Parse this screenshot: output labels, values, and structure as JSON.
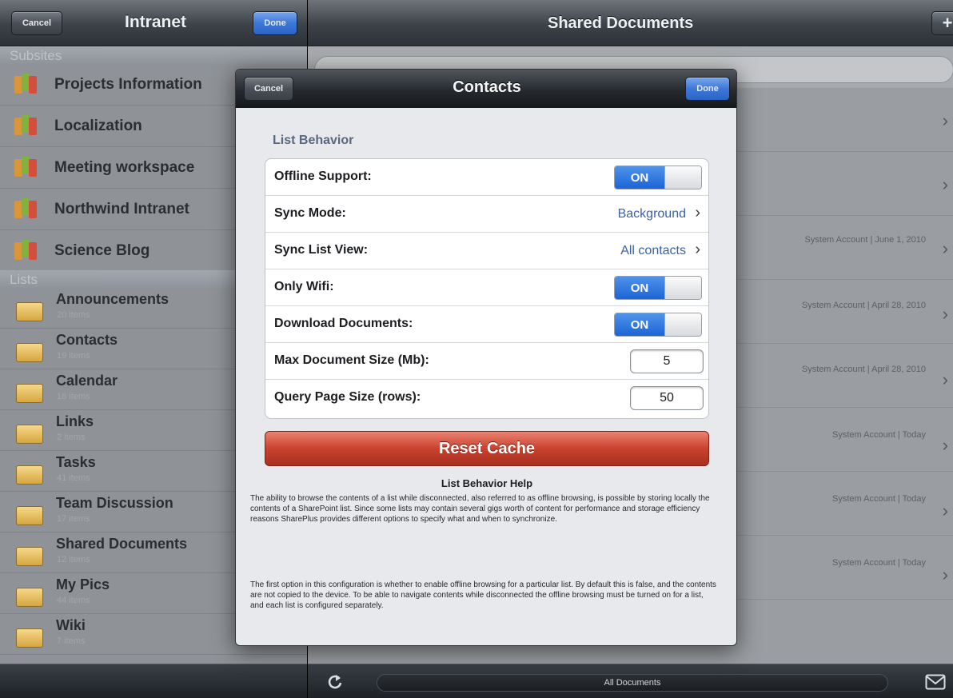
{
  "sidebar": {
    "cancel_label": "Cancel",
    "title": "Intranet",
    "done_label": "Done",
    "subsites_header": "Subsites",
    "subsites": [
      {
        "label": "Projects Information"
      },
      {
        "label": "Localization"
      },
      {
        "label": "Meeting workspace"
      },
      {
        "label": "Northwind Intranet"
      },
      {
        "label": "Science Blog"
      }
    ],
    "lists_header": "Lists",
    "lists": [
      {
        "label": "Announcements",
        "count": "20 items"
      },
      {
        "label": "Contacts",
        "count": "19 items"
      },
      {
        "label": "Calendar",
        "count": "16 items"
      },
      {
        "label": "Links",
        "count": "2 items"
      },
      {
        "label": "Tasks",
        "count": "41 items"
      },
      {
        "label": "Team Discussion",
        "count": "17 items"
      },
      {
        "label": "Shared Documents",
        "count": "12 items"
      },
      {
        "label": "My Pics",
        "count": "44 items"
      },
      {
        "label": "Wiki",
        "count": "7 items"
      }
    ]
  },
  "main": {
    "title": "Shared Documents",
    "add_label": "+",
    "rows": [
      {
        "meta": ""
      },
      {
        "meta": ""
      },
      {
        "meta": "System Account | June 1, 2010"
      },
      {
        "meta": "System Account | April 28, 2010"
      },
      {
        "meta": "System Account | April 28, 2010"
      },
      {
        "meta": "System Account | Today"
      },
      {
        "meta": "System Account | Today"
      },
      {
        "meta": "System Account | Today"
      }
    ],
    "toolbar_label": "All Documents"
  },
  "modal": {
    "cancel_label": "Cancel",
    "title": "Contacts",
    "done_label": "Done",
    "section_title": "List Behavior",
    "offline_support_label": "Offline Support:",
    "offline_support_state": "ON",
    "sync_mode_label": "Sync Mode:",
    "sync_mode_value": "Background",
    "sync_list_view_label": "Sync List View:",
    "sync_list_view_value": "All contacts",
    "only_wifi_label": "Only Wifi:",
    "only_wifi_state": "ON",
    "download_documents_label": "Download Documents:",
    "download_documents_state": "ON",
    "max_doc_size_label": "Max Document Size (Mb):",
    "max_doc_size_value": "5",
    "query_page_size_label": "Query Page Size (rows):",
    "query_page_size_value": "50",
    "reset_label": "Reset Cache",
    "help_title": "List Behavior Help",
    "help_p1": "The ability to browse the contents of a list while disconnected, also referred to as offline browsing, is possible by storing locally the contents of a SharePoint list. Since some lists may contain several gigs worth of content for performance and storage efficiency reasons SharePlus provides different options to specify what and when to synchronize.",
    "help_p2": "The first option in this configuration is whether to enable offline browsing for a particular list. By default this is false, and the contents are not copied to the device. To be able to navigate contents while disconnected the offline browsing must be turned on for a list, and each list is configured separately."
  },
  "colors": {
    "accent_blue": "#1c64d6",
    "reset_red": "#c9412e",
    "section_title": "#59687e",
    "value_blue": "#3a62a8"
  }
}
